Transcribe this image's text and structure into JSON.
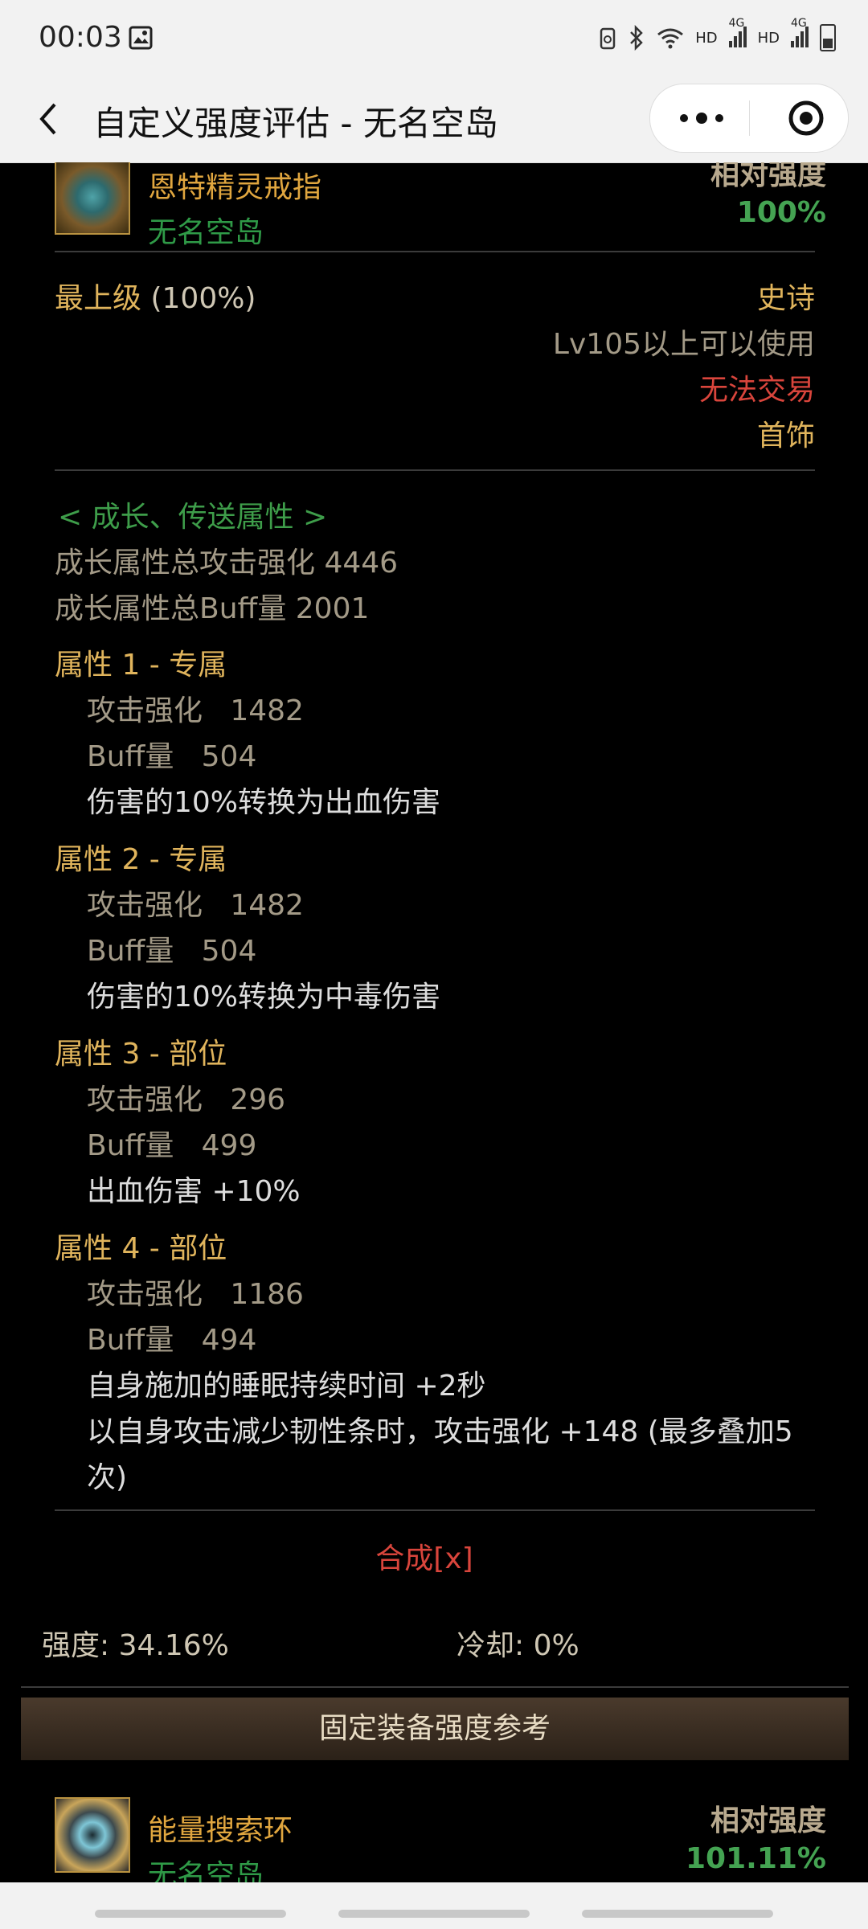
{
  "status_bar": {
    "time": "00:03",
    "icons": [
      "gallery-icon",
      "recycle-icon",
      "bluetooth-icon",
      "wifi-icon",
      "signal-icon",
      "signal-icon",
      "battery-icon"
    ],
    "hd1": "HD",
    "net1": "4G",
    "hd2": "HD",
    "net2": "4G"
  },
  "header": {
    "title": "自定义强度评估 - 无名空岛",
    "more_icon": "more-dots-icon",
    "target_icon": "target-icon"
  },
  "item1": {
    "name": "恩特精灵戒指",
    "origin": "无名空岛",
    "rel_label": "相对强度",
    "rel_value": "100%",
    "grade": "最上级",
    "grade_pct": " (100%)",
    "rarity": "史诗",
    "level_req": "Lv105以上可以使用",
    "trade": "无法交易",
    "slot": "首饰"
  },
  "growth": {
    "section_title": "< 成长、传送属性 >",
    "total_atk": "成长属性总攻击强化 4446",
    "total_buff": "成长属性总Buff量 2001",
    "attrs": [
      {
        "title": "属性 1 - 专属",
        "atk": "攻击强化   1482",
        "buff": "Buff量   504",
        "effects": [
          "伤害的10%转换为出血伤害"
        ]
      },
      {
        "title": "属性 2 - 专属",
        "atk": "攻击强化   1482",
        "buff": "Buff量   504",
        "effects": [
          "伤害的10%转换为中毒伤害"
        ]
      },
      {
        "title": "属性 3 - 部位",
        "atk": "攻击强化   296",
        "buff": "Buff量   499",
        "effects": [
          "出血伤害 +10%"
        ]
      },
      {
        "title": "属性 4 - 部位",
        "atk": "攻击强化   1186",
        "buff": "Buff量   494",
        "effects": [
          "自身施加的睡眠持续时间 +2秒",
          "以自身攻击减少韧性条时，攻击强化 +148 (最多叠加5",
          "次)"
        ]
      }
    ]
  },
  "synth_link": "合成[x]",
  "stats": {
    "strength": "强度: 34.16%",
    "cooldown": "冷却: 0%"
  },
  "fixed_panel_title": "固定装备强度参考",
  "item2": {
    "name": "能量搜索环",
    "origin": "无名空岛",
    "rel_label": "相对强度",
    "rel_value": "101.11%"
  },
  "colors": {
    "gold": "#e0a63f",
    "green": "#2f9a47",
    "red": "#d9453c",
    "muted": "#a39a87"
  }
}
